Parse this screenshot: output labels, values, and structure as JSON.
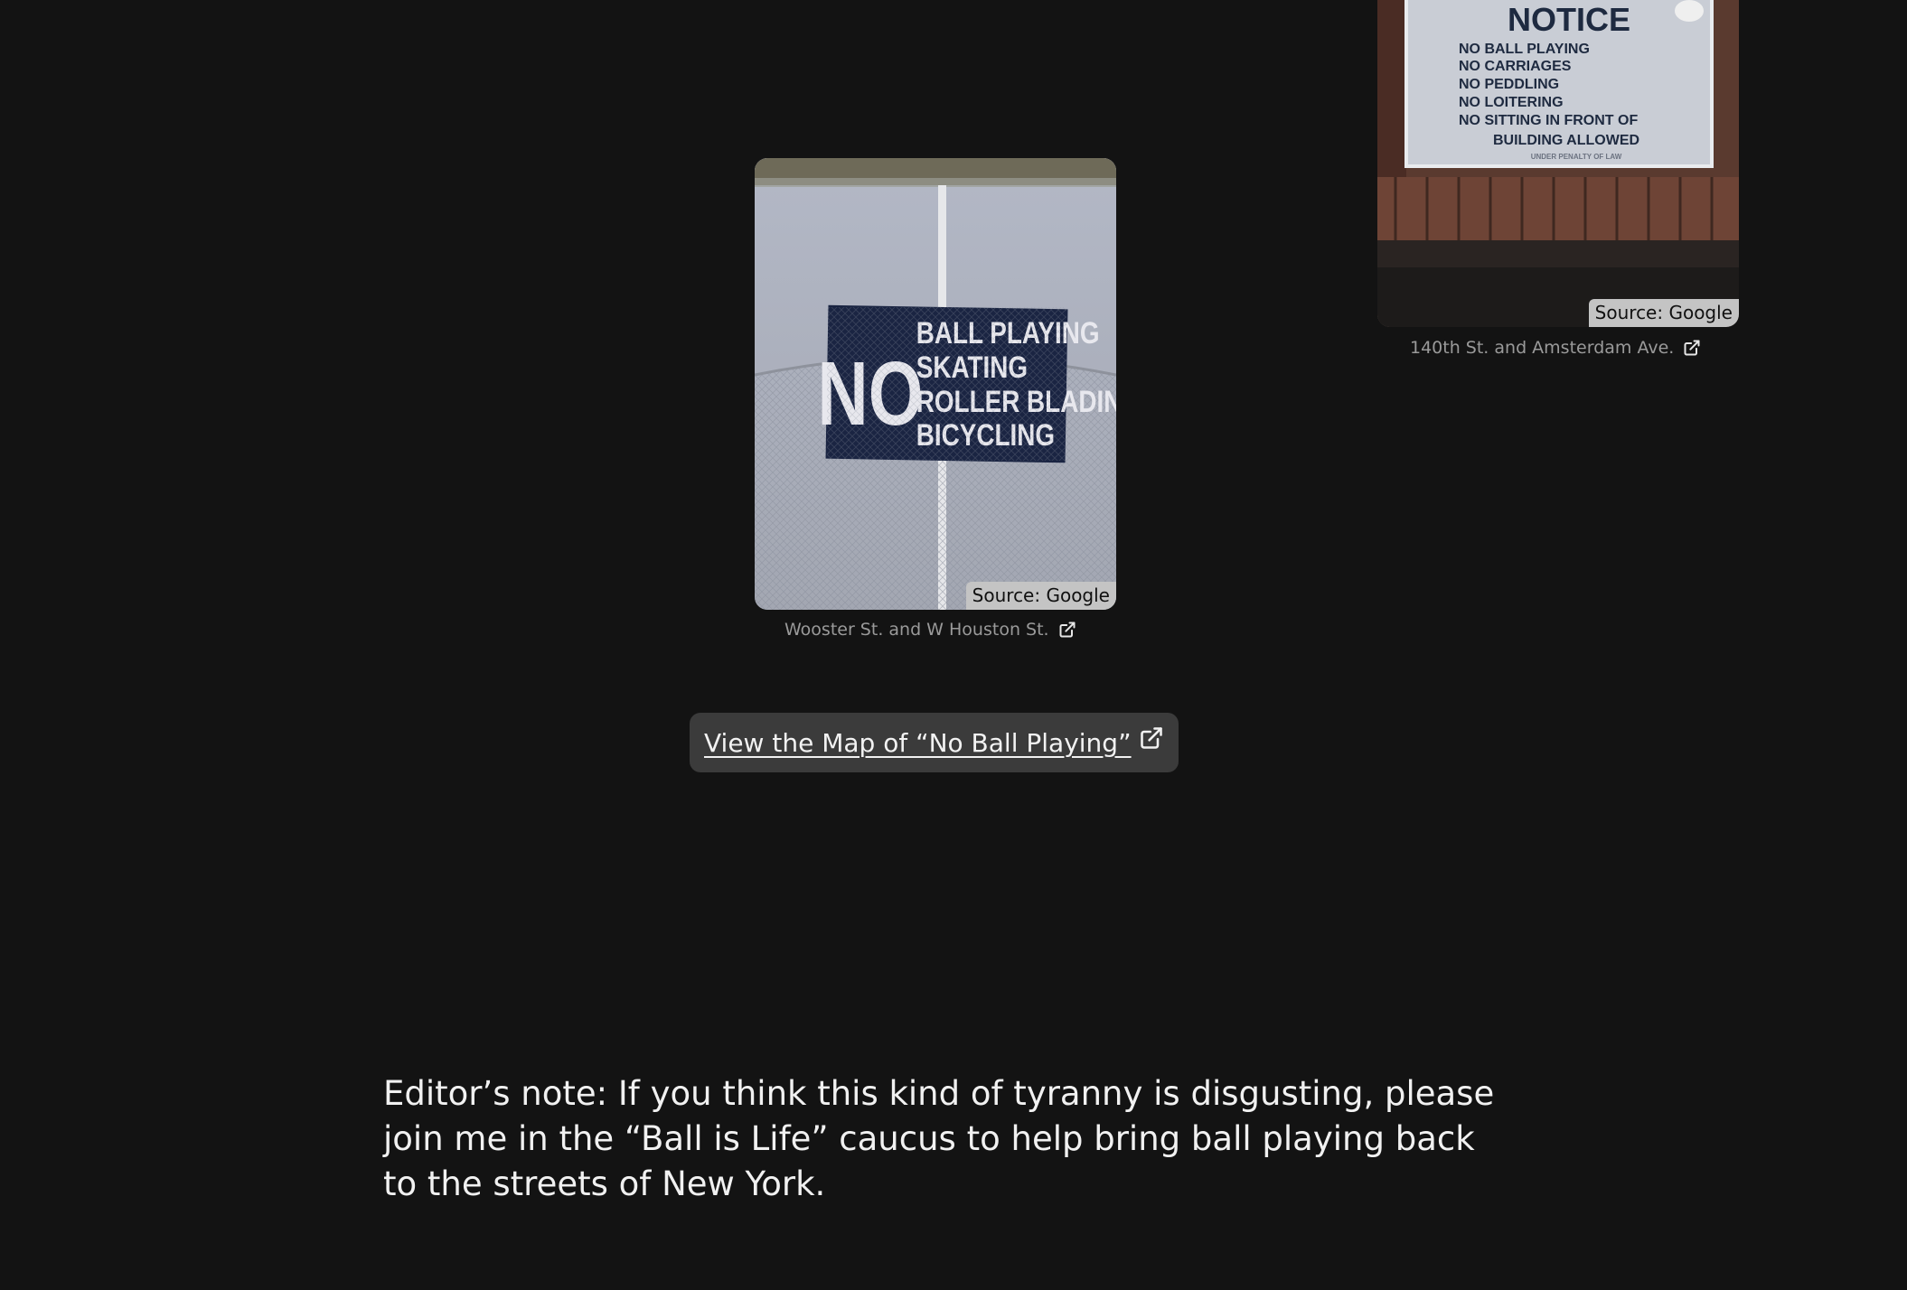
{
  "figures": [
    {
      "source_label": "Source: Google",
      "caption": "Wooster St. and W Houston St.",
      "sign": {
        "big_word": "NO",
        "lines": [
          "BALL PLAYING",
          "SKATING",
          "ROLLER BLADING",
          "BICYCLING"
        ]
      }
    },
    {
      "source_label": "Source: Google",
      "caption": "140th St. and Amsterdam Ave.",
      "sign": {
        "heading": "NOTICE",
        "lines": [
          "NO  BALL  PLAYING",
          "NO  CARRIAGES",
          "NO  PEDDLING",
          "NO  LOITERING",
          "NO  SITTING  IN  FRONT  OF",
          "BUILDING  ALLOWED",
          "UNDER PENALTY OF LAW"
        ]
      }
    }
  ],
  "map_button": {
    "label": "View the Map of “No Ball Playing”",
    "icon": "external-link-icon"
  },
  "editor_note": "Editor’s note: If you think this kind of tyranny is disgusting, please join me in the “Ball is Life” caucus to help bring ball playing back to the streets of New York.",
  "colors": {
    "background": "#131313",
    "button_bg": "#3b3b3b",
    "caption_text": "#9a9a9a",
    "body_text": "#f1f1f1",
    "source_badge_bg": "#c4c4c4"
  }
}
